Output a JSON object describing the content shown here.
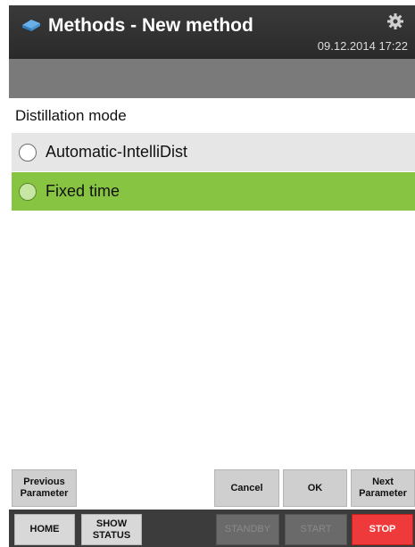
{
  "header": {
    "title": "Methods - New method",
    "datetime": "09.12.2014 17:22",
    "app_icon": "method-icon",
    "settings_icon": "gear-icon"
  },
  "section": {
    "label": "Distillation mode"
  },
  "options": [
    {
      "label": "Automatic-IntelliDist",
      "selected": false
    },
    {
      "label": "Fixed time",
      "selected": true
    }
  ],
  "actions": {
    "previous": "Previous Parameter",
    "cancel": "Cancel",
    "ok": "OK",
    "next": "Next Parameter"
  },
  "footer": {
    "home": "HOME",
    "show_status": "SHOW STATUS",
    "standby": "STANDBY",
    "start": "START",
    "stop": "STOP"
  },
  "colors": {
    "selected_row": "#86c441",
    "stop_button": "#ee3a3a",
    "header_bg": "#2e2e2e"
  }
}
